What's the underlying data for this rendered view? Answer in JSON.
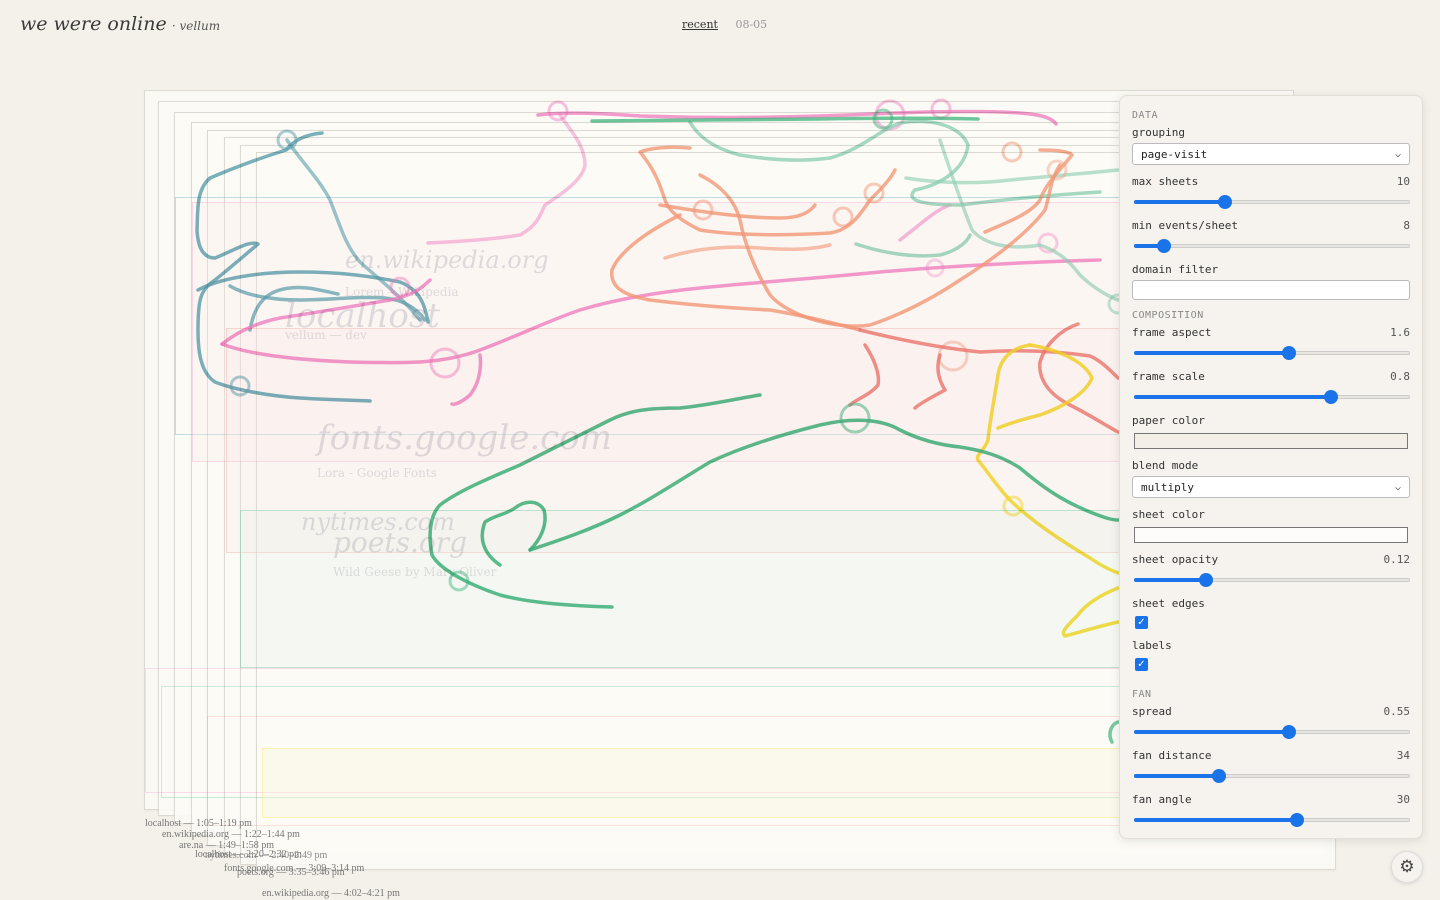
{
  "header": {
    "title": "we were online",
    "subtitle": "· vellum",
    "nav_recent": "recent",
    "nav_date": "08-05"
  },
  "sheet_labels": [
    "localhost — 1:05–1:19 pm",
    "en.wikipedia.org — 1:22–1:44 pm",
    "are.na — 1:49–1:58 pm",
    "localhost — 2:20–2:32 pm",
    "nytimes.com — 2:40–2:49 pm",
    "fonts.google.com — 3:09–3:14 pm",
    "poets.org — 3:35–3:46 pm",
    "en.wikipedia.org — 4:02–4:21 pm"
  ],
  "ghost_text": {
    "wiki": "en.wikipedia.org",
    "wiki_sub": "Lorem – Wikipedia",
    "localhost": "localhost",
    "localhost_sub": "vellum — dev",
    "fonts": "fonts.google.com",
    "fonts_sub": "Lora - Google Fonts",
    "nytimes": "nytimes.com",
    "poets": "poets.org",
    "poets_sub": "Wild Geese by Mary Oliver"
  },
  "panel": {
    "data_header": "DATA",
    "grouping_label": "grouping",
    "grouping_value": "page-visit",
    "max_sheets": {
      "label": "max sheets",
      "value": "10",
      "fraction": 0.32
    },
    "min_events": {
      "label": "min events/sheet",
      "value": "8",
      "fraction": 0.1
    },
    "domain_filter_label": "domain filter",
    "domain_filter_value": "",
    "composition_header": "COMPOSITION",
    "frame_aspect": {
      "label": "frame aspect",
      "value": "1.6",
      "fraction": 0.55
    },
    "frame_scale": {
      "label": "frame scale",
      "value": "0.8",
      "fraction": 0.7
    },
    "paper_color_label": "paper color",
    "paper_color": "#f3efe7",
    "blend_mode_label": "blend mode",
    "blend_mode_value": "multiply",
    "sheet_color_label": "sheet color",
    "sheet_color": "#fdfcfa",
    "sheet_opacity": {
      "label": "sheet opacity",
      "value": "0.12",
      "fraction": 0.25
    },
    "sheet_edges_label": "sheet edges",
    "sheet_edges_checked": true,
    "labels_label": "labels",
    "labels_checked": true,
    "fan_header": "FAN",
    "spread": {
      "label": "spread",
      "value": "0.55",
      "fraction": 0.55
    },
    "fan_distance": {
      "label": "fan distance",
      "value": "34",
      "fraction": 0.3
    },
    "fan_angle": {
      "label": "fan angle",
      "value": "30",
      "fraction": 0.58
    }
  },
  "colors": {
    "accent": "#1a73e8",
    "teal": "#5aa0b0",
    "pink": "#f07cc4",
    "green": "#3fb57f",
    "mint": "#8ad0b4",
    "salmon": "#f59c7c",
    "coral": "#ee7a72",
    "yellow": "#f4dc2e"
  },
  "icons": {
    "settings": "gear-icon",
    "dropdown": "chevron-down-icon"
  }
}
